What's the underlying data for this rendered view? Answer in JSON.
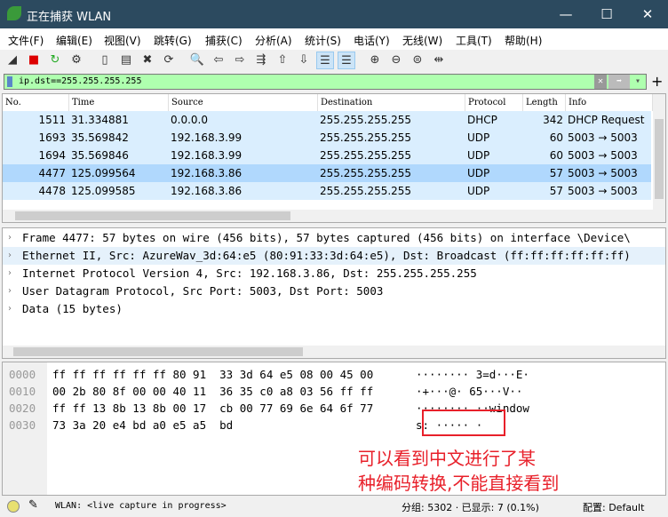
{
  "window": {
    "title": "正在捕获 WLAN",
    "minimize": "—",
    "maximize": "☐",
    "close": "✕"
  },
  "menu": [
    "文件(F)",
    "编辑(E)",
    "视图(V)",
    "跳转(G)",
    "捕获(C)",
    "分析(A)",
    "统计(S)",
    "电话(Y)",
    "无线(W)",
    "工具(T)",
    "帮助(H)"
  ],
  "toolbar": [
    {
      "icon": "shark-fin-start-icon",
      "g": "◢"
    },
    {
      "icon": "stop-capture-icon",
      "g": "■"
    },
    {
      "icon": "restart-capture-icon",
      "g": "↻"
    },
    {
      "icon": "capture-options-icon",
      "g": "⚙"
    },
    {
      "icon": "open-file-icon",
      "g": "▯"
    },
    {
      "icon": "save-file-icon",
      "g": "▤"
    },
    {
      "icon": "close-file-icon",
      "g": "✖"
    },
    {
      "icon": "reload-file-icon",
      "g": "⟳"
    },
    {
      "icon": "find-packet-icon",
      "g": "🔍"
    },
    {
      "icon": "go-back-icon",
      "g": "⇦"
    },
    {
      "icon": "go-forward-icon",
      "g": "⇨"
    },
    {
      "icon": "go-to-packet-icon",
      "g": "⇶"
    },
    {
      "icon": "go-first-icon",
      "g": "⇧"
    },
    {
      "icon": "go-last-icon",
      "g": "⇩"
    },
    {
      "icon": "auto-scroll-icon",
      "g": "☰",
      "on": true
    },
    {
      "icon": "colorize-icon",
      "g": "☰",
      "on": true
    },
    {
      "icon": "zoom-in-icon",
      "g": "⊕"
    },
    {
      "icon": "zoom-out-icon",
      "g": "⊖"
    },
    {
      "icon": "zoom-reset-icon",
      "g": "⊜"
    },
    {
      "icon": "resize-columns-icon",
      "g": "⇹"
    }
  ],
  "filter": {
    "value": "ip.dst==255.255.255.255",
    "clear": "✕",
    "apply": "➡",
    "dropdown": "▾",
    "add": "+"
  },
  "packet_list": {
    "columns": [
      "No.",
      "Time",
      "Source",
      "Destination",
      "Protocol",
      "Length",
      "Info"
    ],
    "rows": [
      [
        "1511",
        "31.334881",
        "0.0.0.0",
        "255.255.255.255",
        "DHCP",
        "342",
        "DHCP Request"
      ],
      [
        "1693",
        "35.569842",
        "192.168.3.99",
        "255.255.255.255",
        "UDP",
        "60",
        "5003 → 5003"
      ],
      [
        "1694",
        "35.569846",
        "192.168.3.99",
        "255.255.255.255",
        "UDP",
        "60",
        "5003 → 5003"
      ],
      [
        "4477",
        "125.099564",
        "192.168.3.86",
        "255.255.255.255",
        "UDP",
        "57",
        "5003 → 5003"
      ],
      [
        "4478",
        "125.099585",
        "192.168.3.86",
        "255.255.255.255",
        "UDP",
        "57",
        "5003 → 5003"
      ]
    ],
    "selected_index": 3
  },
  "details": [
    "Frame 4477: 57 bytes on wire (456 bits), 57 bytes captured (456 bits) on interface \\Device\\",
    "Ethernet II, Src: AzureWav_3d:64:e5 (80:91:33:3d:64:e5), Dst: Broadcast (ff:ff:ff:ff:ff:ff)",
    "Internet Protocol Version 4, Src: 192.168.3.86, Dst: 255.255.255.255",
    "User Datagram Protocol, Src Port: 5003, Dst Port: 5003",
    "Data (15 bytes)"
  ],
  "hex": [
    {
      "offset": "0000",
      "bytes": "ff ff ff ff ff ff 80 91  33 3d 64 e5 08 00 45 00",
      "ascii": "········ 3=d···E·"
    },
    {
      "offset": "0010",
      "bytes": "00 2b 80 8f 00 00 40 11  36 35 c0 a8 03 56 ff ff",
      "ascii": "·+···@· 65···V··"
    },
    {
      "offset": "0020",
      "bytes": "ff ff 13 8b 13 8b 00 17  cb 00 77 69 6e 64 6f 77",
      "ascii": "········ ··window"
    },
    {
      "offset": "0030",
      "bytes": "73 3a 20 e4 bd a0 e5 a5  bd",
      "ascii": "s: ····· ·"
    }
  ],
  "annotation": {
    "line1": "可以看到中文进行了某",
    "line2": "种编码转换,不能直接看到",
    "color": "#e8202a"
  },
  "status": {
    "text": "WLAN: <live capture in progress>",
    "packets": "分组: 5302 · 已显示: 7 (0.1%)",
    "profile": "配置: Default"
  }
}
